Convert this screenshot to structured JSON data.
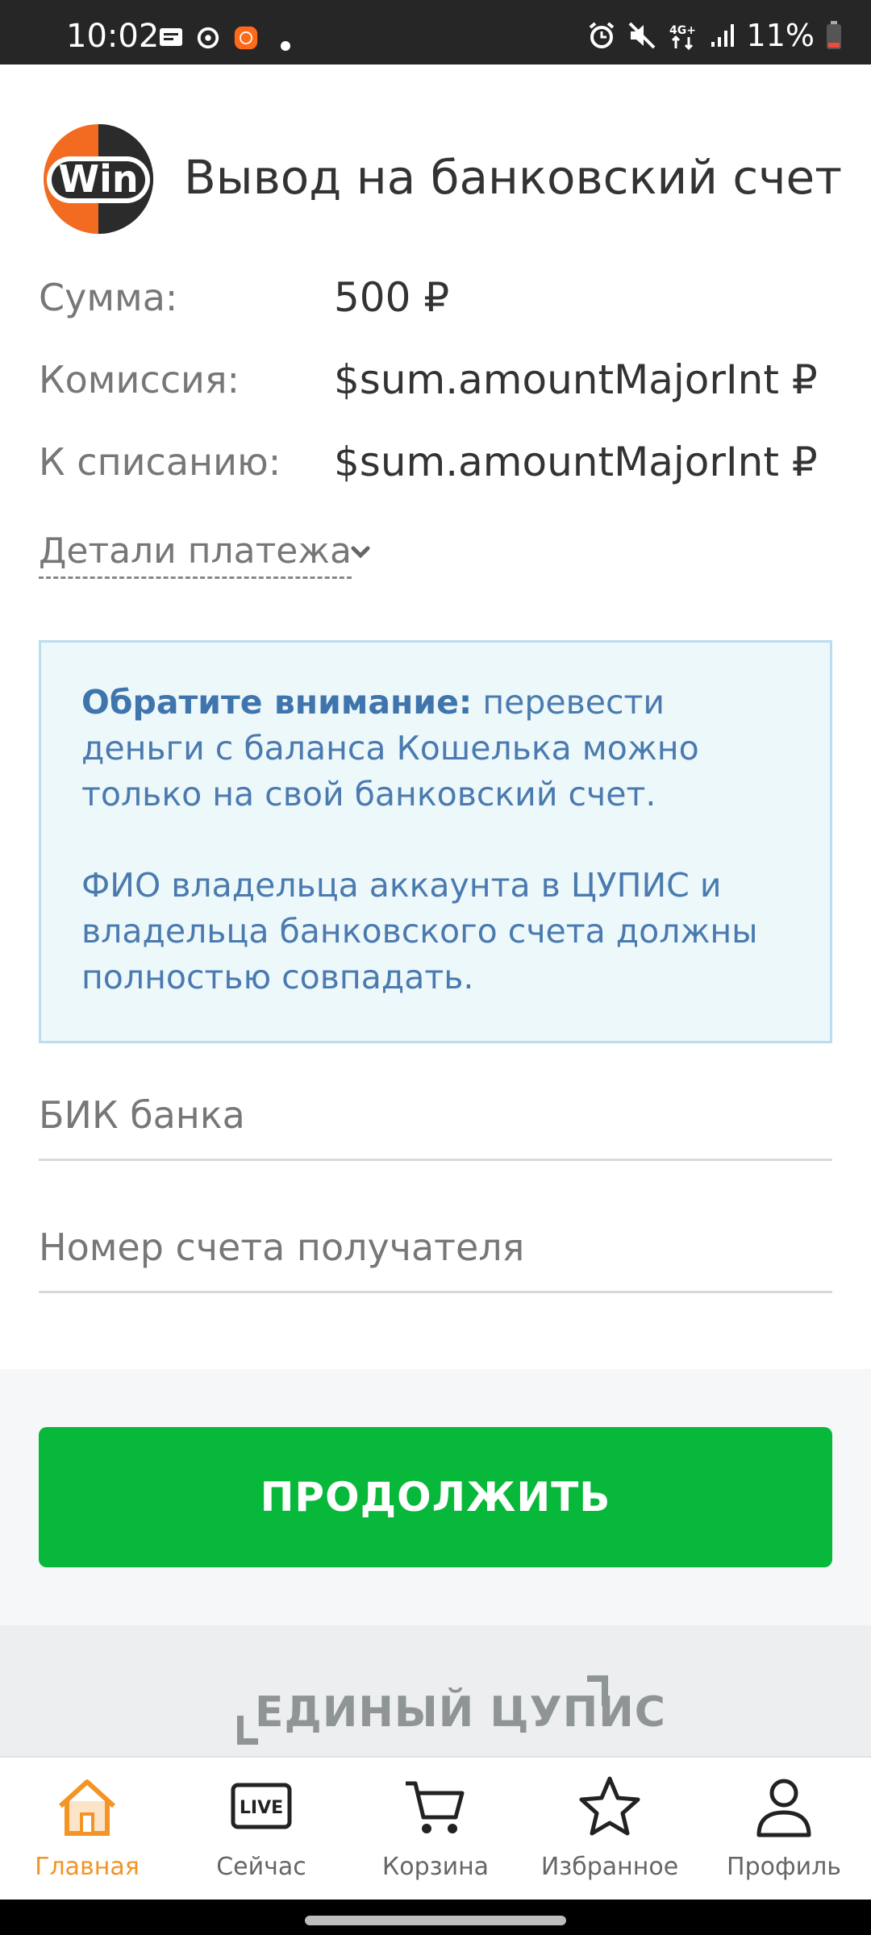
{
  "status_bar": {
    "time": "10:02",
    "battery": "11%",
    "network": "4G+"
  },
  "header": {
    "logo_text": "Win",
    "title": "Вывод на банковский счет"
  },
  "summary": {
    "amount_label": "Сумма:",
    "amount_value": "500 ₽",
    "fee_label": "Комиссия:",
    "fee_value": "$sum.amountMajorInt ₽",
    "debit_label": "К списанию:",
    "debit_value": "$sum.amountMajorInt ₽"
  },
  "details_link": "Детали платежа",
  "notice": {
    "bold": "Обратите внимание:",
    "text1": " перевести деньги с баланса Кошелька можно только на свой банковский счет.",
    "text2": "ФИО владельца аккаунта в ЦУПИС и владельца банковского счета должны полностью совпадать."
  },
  "form": {
    "bik_placeholder": "БИК банка",
    "bik_value": "",
    "account_placeholder": "Номер счета получателя",
    "account_value": ""
  },
  "continue_label": "ПРОДОЛЖИТЬ",
  "footer": {
    "brand": "ЕДИНЫЙ ЦУПИС"
  },
  "nav": {
    "items": [
      {
        "label": "Главная",
        "icon": "home-icon",
        "active": true
      },
      {
        "label": "Сейчас",
        "icon": "live-icon",
        "active": false
      },
      {
        "label": "Корзина",
        "icon": "cart-icon",
        "active": false
      },
      {
        "label": "Избранное",
        "icon": "star-icon",
        "active": false
      },
      {
        "label": "Профиль",
        "icon": "profile-icon",
        "active": false
      }
    ]
  },
  "colors": {
    "accent": "#f39425",
    "primary_button": "#08b83a",
    "notice_bg": "#edf8fb",
    "notice_text": "#4a7aaf"
  }
}
